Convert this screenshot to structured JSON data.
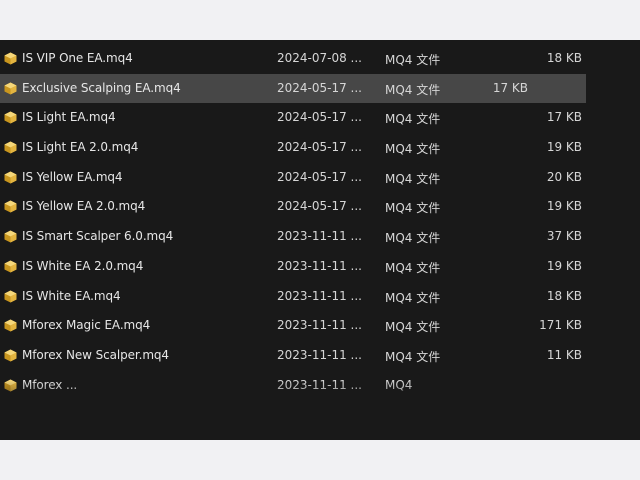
{
  "files": [
    {
      "name": "IS VIP One EA.mq4",
      "date": "2024-07-08 ...",
      "type": "MQ4 文件",
      "size": "18 KB",
      "selected": false
    },
    {
      "name": "Exclusive Scalping EA.mq4",
      "date": "2024-05-17 ...",
      "type": "MQ4 文件",
      "size": "17 KB",
      "selected": true
    },
    {
      "name": "IS Light EA.mq4",
      "date": "2024-05-17 ...",
      "type": "MQ4 文件",
      "size": "17 KB",
      "selected": false
    },
    {
      "name": "IS Light EA 2.0.mq4",
      "date": "2024-05-17 ...",
      "type": "MQ4 文件",
      "size": "19 KB",
      "selected": false
    },
    {
      "name": "IS Yellow EA.mq4",
      "date": "2024-05-17 ...",
      "type": "MQ4 文件",
      "size": "20 KB",
      "selected": false
    },
    {
      "name": "IS Yellow EA 2.0.mq4",
      "date": "2024-05-17 ...",
      "type": "MQ4 文件",
      "size": "19 KB",
      "selected": false
    },
    {
      "name": "IS Smart Scalper 6.0.mq4",
      "date": "2023-11-11 ...",
      "type": "MQ4 文件",
      "size": "37 KB",
      "selected": false
    },
    {
      "name": "IS White EA 2.0.mq4",
      "date": "2023-11-11 ...",
      "type": "MQ4 文件",
      "size": "19 KB",
      "selected": false
    },
    {
      "name": "IS White EA.mq4",
      "date": "2023-11-11 ...",
      "type": "MQ4 文件",
      "size": "18 KB",
      "selected": false
    },
    {
      "name": "Mforex Magic EA.mq4",
      "date": "2023-11-11 ...",
      "type": "MQ4 文件",
      "size": "171 KB",
      "selected": false
    },
    {
      "name": "Mforex New Scalper.mq4",
      "date": "2023-11-11 ...",
      "type": "MQ4 文件",
      "size": "11 KB",
      "selected": false
    },
    {
      "name": "Mforex ...",
      "date": "2023-11-11 ...",
      "type": "MQ4",
      "size": "",
      "selected": false
    }
  ],
  "icon": {
    "name": "mq4-file-icon",
    "color_light": "#f5d77a",
    "color_dark": "#c9961e"
  },
  "colors": {
    "background": "#191919",
    "selected": "#474747",
    "text": "#e6e6e6"
  }
}
